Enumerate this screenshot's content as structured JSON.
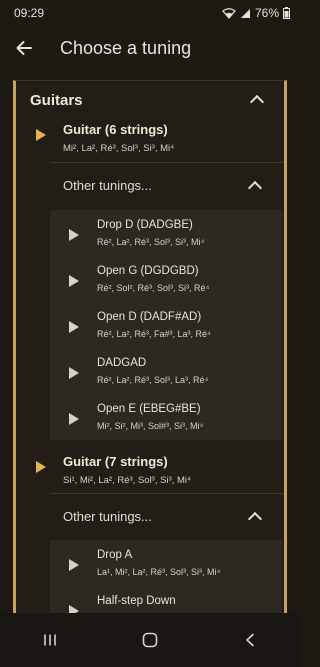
{
  "status": {
    "time": "09:29",
    "battery": "76%"
  },
  "app_bar": {
    "title": "Choose a tuning"
  },
  "section": {
    "title": "Guitars",
    "groups": [
      {
        "title": "Guitar (6 strings)",
        "notes": "Mi², La², Ré³, Sol³, Si³, Mi⁴",
        "other_label": "Other tunings...",
        "tunings": [
          {
            "title": "Drop D (DADGBE)",
            "notes": "Ré², La², Ré³, Sol³, Si³, Mi⁴"
          },
          {
            "title": "Open G (DGDGBD)",
            "notes": "Ré², Sol², Ré³, Sol³, Si³, Ré⁴"
          },
          {
            "title": "Open D (DADF#AD)",
            "notes": "Ré², La², Ré³, Fa#³, La³, Ré⁴"
          },
          {
            "title": "DADGAD",
            "notes": "Ré², La², Ré³, Sol³, La³, Ré⁴"
          },
          {
            "title": "Open E (EBEG#BE)",
            "notes": "Mi², Si², Mi³, Sol#³, Si³, Mi⁴"
          }
        ]
      },
      {
        "title": "Guitar (7 strings)",
        "notes": "Si¹, Mi², La², Ré³, Sol³, Si³, Mi⁴",
        "other_label": "Other tunings...",
        "tunings": [
          {
            "title": "Drop A",
            "notes": "La¹, Mi², La², Ré³, Sol³, Si³, Mi⁴"
          },
          {
            "title": "Half-step Down",
            "notes": ""
          }
        ]
      }
    ]
  },
  "icons": {
    "back": "arrow-left-icon",
    "recents": "recents-icon",
    "home": "home-icon",
    "nav_back": "nav-back-icon"
  }
}
